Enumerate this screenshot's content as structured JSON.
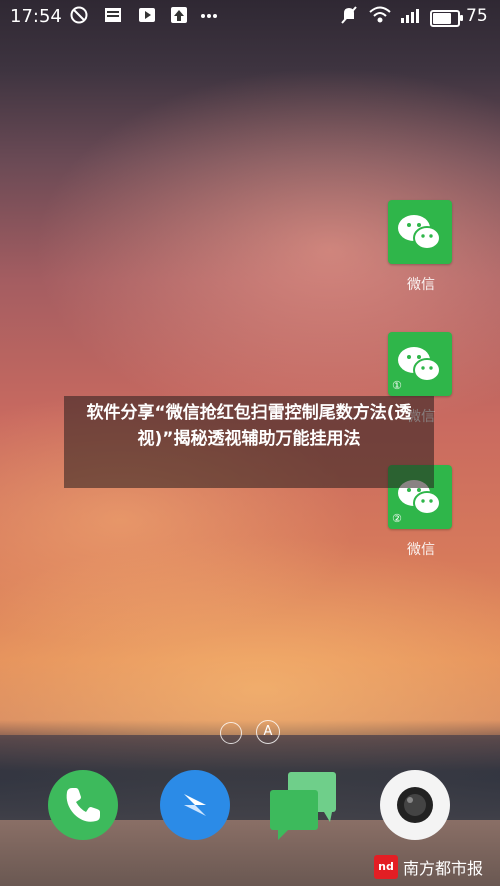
{
  "status_bar": {
    "time": "17:54",
    "battery_percent": "75",
    "battery_level": 0.75,
    "left_icons": [
      "do-not-disturb-icon",
      "news-icon",
      "play-icon",
      "upload-icon",
      "more-icon"
    ],
    "right_icons": [
      "mute-icon",
      "wifi-icon",
      "signal-icon",
      "battery-icon"
    ]
  },
  "apps": [
    {
      "label": "微信",
      "icon": "wechat-icon",
      "badge": ""
    },
    {
      "label": "微信",
      "icon": "wechat-icon",
      "badge": "①"
    },
    {
      "label": "微信",
      "icon": "wechat-icon",
      "badge": "②"
    }
  ],
  "caption": {
    "text": "软件分享“微信抢红包扫雷控制尾数方法(透视)”揭秘透视辅助万能挂用法"
  },
  "page_indicator": {
    "letter": "A"
  },
  "dock": [
    "phone-icon",
    "browser-icon",
    "messages-icon",
    "camera-icon"
  ],
  "watermark": {
    "logo_text": "nd",
    "text": "南方都市报"
  },
  "colors": {
    "wechat_green": "#2fb64a",
    "phone_green": "#3dba5c",
    "browser_blue": "#2b8be7",
    "watermark_red": "#e31e24"
  }
}
